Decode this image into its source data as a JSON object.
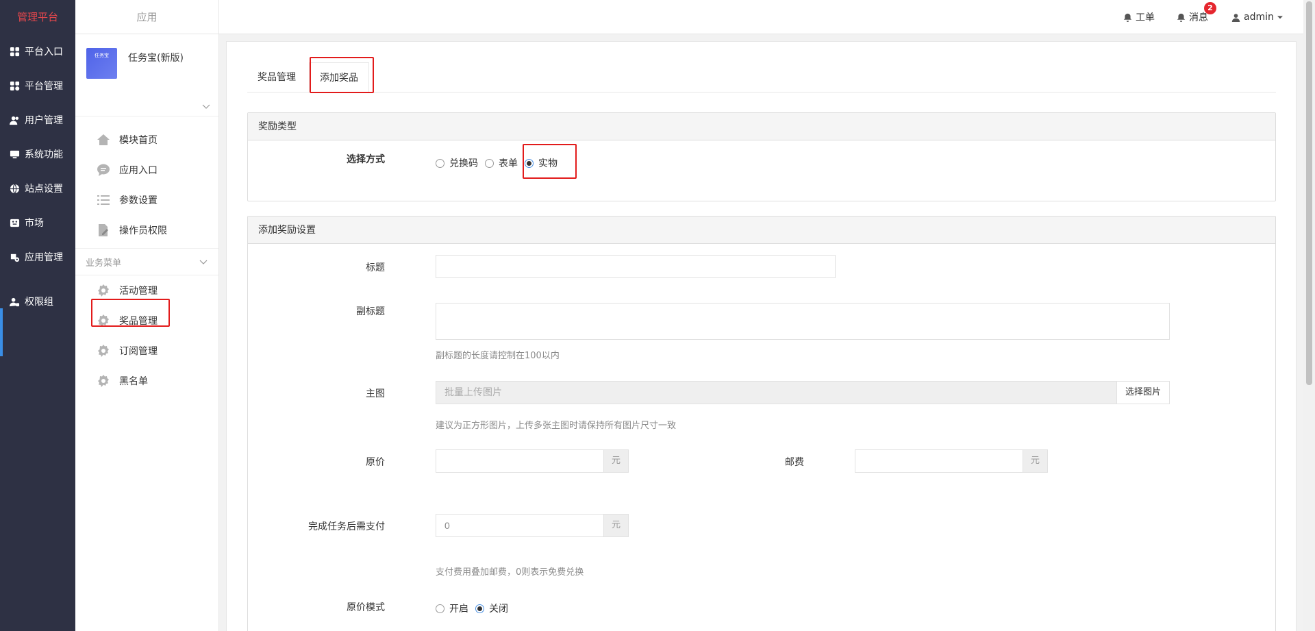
{
  "leftnav": {
    "brand": "管理平台",
    "items": [
      {
        "label": "平台入口"
      },
      {
        "label": "平台管理"
      },
      {
        "label": "用户管理"
      },
      {
        "label": "系统功能"
      },
      {
        "label": "站点设置"
      },
      {
        "label": "市场"
      },
      {
        "label": "应用管理"
      },
      {
        "label": "权限组"
      }
    ]
  },
  "subnav": {
    "header": "应用",
    "app_name": "任务宝(新版)",
    "app_logo_text": "任务宝",
    "menu": [
      {
        "label": "模块首页"
      },
      {
        "label": "应用入口"
      },
      {
        "label": "参数设置"
      },
      {
        "label": "操作员权限"
      }
    ],
    "section_title": "业务菜单",
    "business_menu": [
      {
        "label": "活动管理"
      },
      {
        "label": "奖品管理"
      },
      {
        "label": "订阅管理"
      },
      {
        "label": "黑名单"
      }
    ]
  },
  "topbar": {
    "workorder": "工单",
    "messages": "消息",
    "message_count": "2",
    "user": "admin"
  },
  "tabs": [
    {
      "label": "奖品管理",
      "active": false
    },
    {
      "label": "添加奖品",
      "active": true
    }
  ],
  "reward_type": {
    "title": "奖励类型",
    "select_label": "选择方式",
    "options": [
      {
        "label": "兑换码",
        "checked": false
      },
      {
        "label": "表单",
        "checked": false
      },
      {
        "label": "实物",
        "checked": true
      }
    ]
  },
  "reward_settings": {
    "title": "添加奖励设置",
    "title_label": "标题",
    "title_value": "",
    "subtitle_label": "副标题",
    "subtitle_value": "",
    "subtitle_help": "副标题的长度请控制在100以内",
    "image_label": "主图",
    "image_placeholder": "批量上传图片",
    "image_button": "选择图片",
    "image_help": "建议为正方形图片，上传多张主图时请保持所有图片尺寸一致",
    "price_label": "原价",
    "price_value": "",
    "price_unit": "元",
    "postage_label": "邮费",
    "postage_value": "",
    "postage_unit": "元",
    "pay_label": "完成任务后需支付",
    "pay_value": "0",
    "pay_unit": "元",
    "pay_help": "支付费用叠加邮费，0则表示免费兑换",
    "original_mode_label": "原价模式",
    "original_mode_options": [
      {
        "label": "开启",
        "checked": false
      },
      {
        "label": "关闭",
        "checked": true
      }
    ]
  }
}
